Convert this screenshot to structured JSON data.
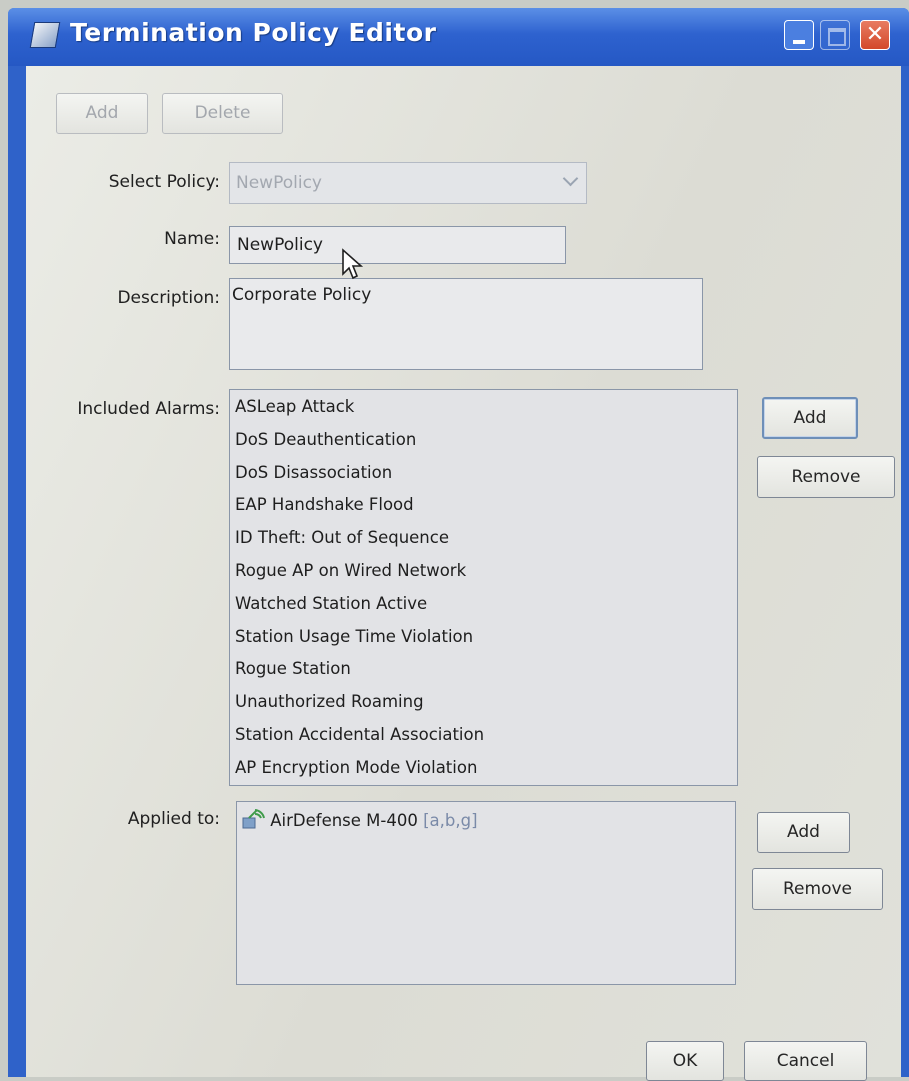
{
  "window": {
    "title": "Termination Policy Editor",
    "close_glyph": "✕"
  },
  "toolbar": {
    "add_label": "Add",
    "delete_label": "Delete"
  },
  "form": {
    "select_policy": {
      "label": "Select Policy:",
      "value": "NewPolicy"
    },
    "name": {
      "label": "Name:",
      "value": "NewPolicy"
    },
    "description": {
      "label": "Description:",
      "value": "Corporate Policy"
    },
    "included_alarms": {
      "label": "Included Alarms:",
      "items": [
        "ASLeap Attack",
        "DoS Deauthentication",
        "DoS Disassociation",
        "EAP Handshake Flood",
        "ID Theft: Out of Sequence",
        "Rogue AP on Wired Network",
        "Watched Station Active",
        "Station Usage Time Violation",
        "Rogue Station",
        "Unauthorized Roaming",
        "Station Accidental Association",
        "AP Encryption Mode Violation"
      ],
      "add_label": "Add",
      "remove_label": "Remove"
    },
    "applied_to": {
      "label": "Applied to:",
      "items": [
        {
          "name": "AirDefense M-400",
          "tag": "[a,b,g]",
          "icon": "sensor-icon"
        }
      ],
      "add_label": "Add",
      "remove_label": "Remove"
    }
  },
  "footer": {
    "ok_label": "OK",
    "cancel_label": "Cancel"
  },
  "colors": {
    "titlebar": "#2e62cf",
    "client_background": "#e1e2dc",
    "close_button": "#d3482a"
  }
}
